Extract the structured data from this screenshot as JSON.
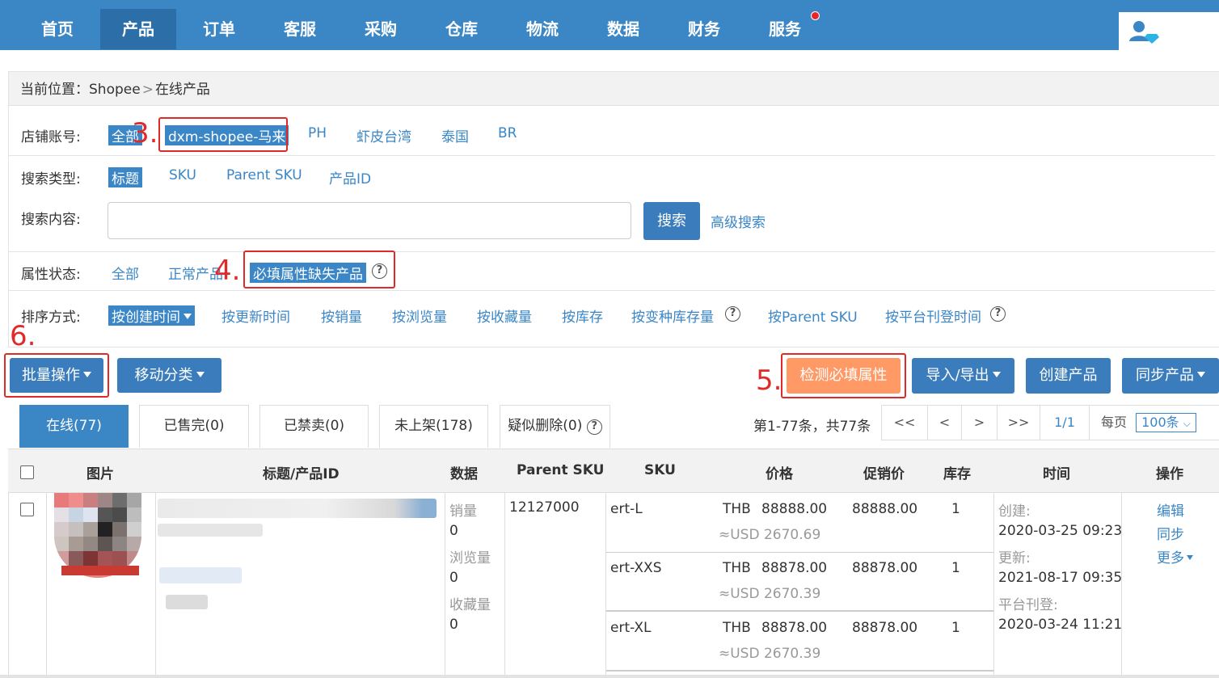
{
  "nav": {
    "items": [
      "首页",
      "产品",
      "订单",
      "客服",
      "采购",
      "仓库",
      "物流",
      "数据",
      "财务",
      "服务"
    ],
    "active": "产品"
  },
  "breadcrumb": {
    "label": "当前位置：",
    "root": "Shopee",
    "sep": ">",
    "current": "在线产品"
  },
  "filters": {
    "shop": {
      "label": "店铺账号:",
      "options": [
        "全部",
        "dxm-shopee-马来",
        "PH",
        "虾皮台湾",
        "泰国",
        "BR"
      ]
    },
    "search_type": {
      "label": "搜索类型:",
      "options": [
        "标题",
        "SKU",
        "Parent SKU",
        "产品ID"
      ]
    },
    "search_content": {
      "label": "搜索内容:",
      "value": "",
      "button": "搜索",
      "advanced": "高级搜索"
    },
    "attr_status": {
      "label": "属性状态:",
      "options": [
        "全部",
        "正常产品",
        "必填属性缺失产品"
      ]
    },
    "sort": {
      "label": "排序方式:",
      "options": [
        "按创建时间",
        "按更新时间",
        "按销量",
        "按浏览量",
        "按收藏量",
        "按库存",
        "按变种库存量",
        "按Parent SKU",
        "按平台刊登时间"
      ]
    }
  },
  "steps": {
    "s3": "3.",
    "s4": "4.",
    "s5": "5.",
    "s6": "6."
  },
  "toolbar": {
    "batch": "批量操作",
    "move": "移动分类",
    "check_attr": "检测必填属性",
    "import_export": "导入/导出",
    "create": "创建产品",
    "sync": "同步产品"
  },
  "tabs": [
    "在线(77)",
    "已售完(0)",
    "已禁卖(0)",
    "未上架(178)",
    "疑似删除(0)"
  ],
  "pagination": {
    "summary": "第1-77条，共77条",
    "first": "<<",
    "prev": "<",
    "next": ">",
    "last": ">>",
    "page": "1/1",
    "per_page_label": "每页",
    "per_page": "100条"
  },
  "table": {
    "headers": [
      "图片",
      "标题/产品ID",
      "数据",
      "Parent SKU",
      "SKU",
      "价格",
      "促销价",
      "库存",
      "时间",
      "操作"
    ],
    "row": {
      "data_labels": [
        "销量",
        "0",
        "浏览量",
        "0",
        "收藏量",
        "0"
      ],
      "parent_sku": "12127000",
      "variants": [
        {
          "sku": "ert-L",
          "currency": "THB",
          "price": "88888.00",
          "usd": "≈USD 2670.69",
          "promo": "88888.00",
          "stock": "1"
        },
        {
          "sku": "ert-XXS",
          "currency": "THB",
          "price": "88878.00",
          "usd": "≈USD 2670.39",
          "promo": "88878.00",
          "stock": "1"
        },
        {
          "sku": "ert-XL",
          "currency": "THB",
          "price": "88878.00",
          "usd": "≈USD 2670.39",
          "promo": "88878.00",
          "stock": "1"
        }
      ],
      "time": [
        "创建:",
        "2020-03-25 09:23",
        "更新:",
        "2021-08-17 09:35",
        "平台刊登:",
        "2020-03-24 11:21"
      ],
      "actions": [
        "编辑",
        "同步",
        "更多"
      ]
    }
  },
  "colors": {
    "nav": "#3b86c4",
    "accent": "#3a86c6",
    "highlight_button": "#ff9a66",
    "annotation": "#e02a2a"
  }
}
